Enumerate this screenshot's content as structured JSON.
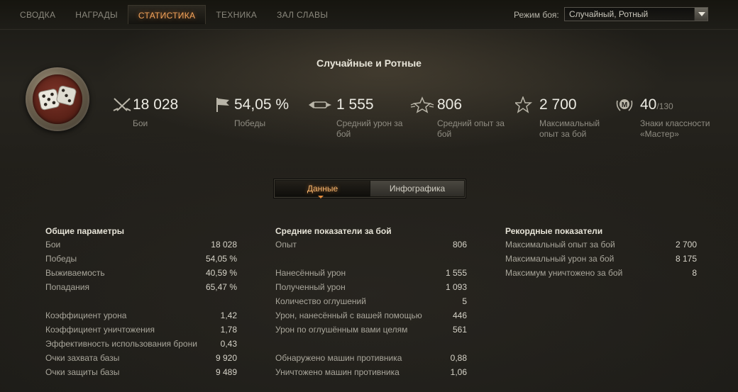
{
  "nav": {
    "tabs": [
      "СВОДКА",
      "НАГРАДЫ",
      "СТАТИСТИКА",
      "ТЕХНИКА",
      "ЗАЛ СЛАВЫ"
    ],
    "active_tab": "СТАТИСТИКА",
    "mode_label": "Режим боя:",
    "mode_value": "Случайный, Ротный"
  },
  "header": {
    "title": "Случайные и Ротные",
    "stats": [
      {
        "icon": "crossed-swords-icon",
        "value": "18 028",
        "label": "Бои"
      },
      {
        "icon": "flag-icon",
        "value": "54,05 %",
        "label": "Победы"
      },
      {
        "icon": "shell-damage-icon",
        "value": "1 555",
        "label": "Средний урон за бой"
      },
      {
        "icon": "star-winged-icon",
        "value": "806",
        "label": "Средний опыт за бой"
      },
      {
        "icon": "star-icon",
        "value": "2 700",
        "label": "Максимальный опыт за бой"
      },
      {
        "icon": "mastery-badge-icon",
        "value": "40",
        "value_suffix": "/130",
        "label": "Знаки классности «Мастер»"
      }
    ]
  },
  "toggle": {
    "active": "Данные",
    "inactive": "Инфографика"
  },
  "general": {
    "title": "Общие параметры",
    "rows": [
      {
        "label": "Бои",
        "value": "18 028"
      },
      {
        "label": "Победы",
        "value": "54,05 %"
      },
      {
        "label": "Выживаемость",
        "value": "40,59 %"
      },
      {
        "label": "Попадания",
        "value": "65,47 %"
      },
      {
        "label": "",
        "value": ""
      },
      {
        "label": "Коэффициент урона",
        "value": "1,42"
      },
      {
        "label": "Коэффициент уничтожения",
        "value": "1,78"
      },
      {
        "label": "Эффективность использования брони",
        "value": "0,43"
      },
      {
        "label": "Очки захвата базы",
        "value": "9 920"
      },
      {
        "label": "Очки защиты базы",
        "value": "9 489"
      }
    ]
  },
  "average": {
    "title": "Средние показатели за бой",
    "rows": [
      {
        "label": "Опыт",
        "value": "806"
      },
      {
        "label": "",
        "value": ""
      },
      {
        "label": "Нанесённый урон",
        "value": "1 555"
      },
      {
        "label": "Полученный урон",
        "value": "1 093"
      },
      {
        "label": "Количество оглушений",
        "value": "5"
      },
      {
        "label": "Урон, нанесённый с вашей помощью",
        "value": "446"
      },
      {
        "label": "Урон по оглушённым вами целям",
        "value": "561"
      },
      {
        "label": "",
        "value": ""
      },
      {
        "label": "Обнаружено машин противника",
        "value": "0,88"
      },
      {
        "label": "Уничтожено машин противника",
        "value": "1,06"
      }
    ]
  },
  "records": {
    "title": "Рекордные показатели",
    "rows": [
      {
        "label": "Максимальный опыт за бой",
        "value": "2 700"
      },
      {
        "label": "Максимальный урон за бой",
        "value": "8 175"
      },
      {
        "label": "Максимум уничтожено за бой",
        "value": "8"
      }
    ]
  }
}
